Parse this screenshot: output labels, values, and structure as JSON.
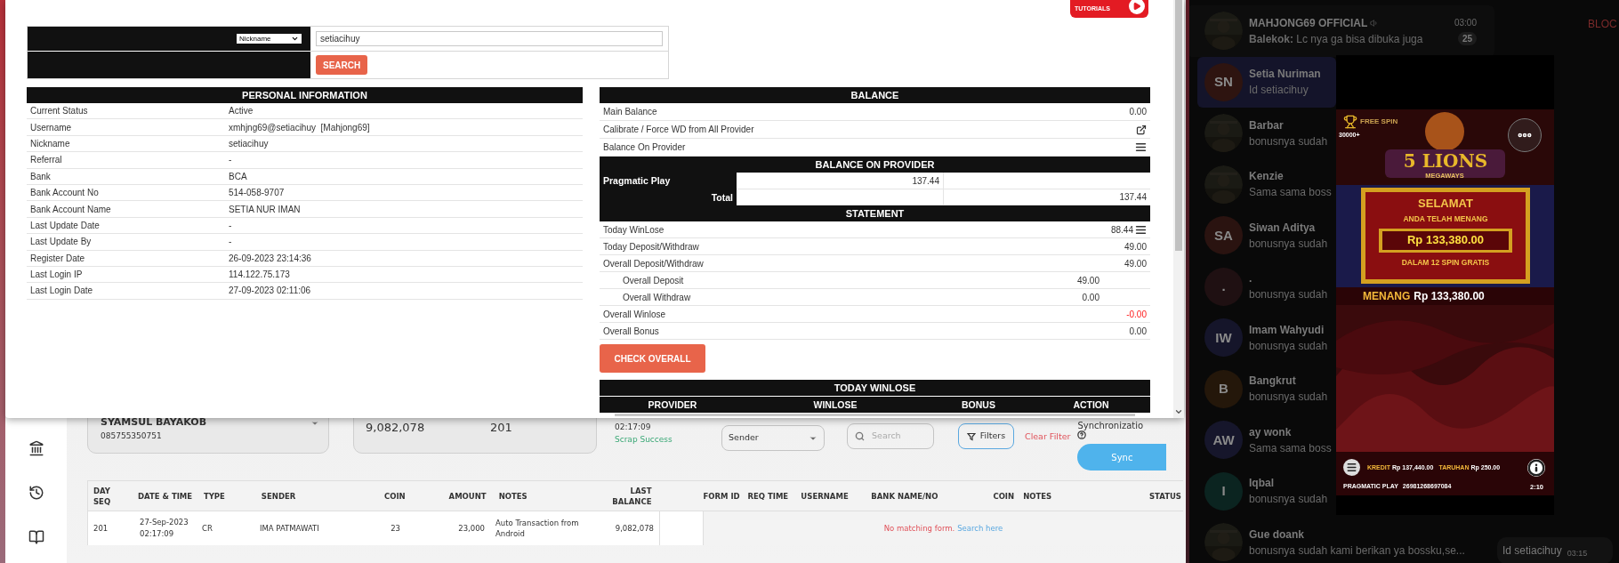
{
  "modal": {
    "logo_text": "TUTORIALS",
    "search": {
      "field": "Nickname",
      "value": "setiacihuy",
      "button": "SEARCH"
    },
    "personal_information": {
      "title": "PERSONAL INFORMATION",
      "rows": [
        {
          "label": "Current Status",
          "value": "Active"
        },
        {
          "label": "Username",
          "value": "xmhjng69@setiacihuy  [Mahjong69]"
        },
        {
          "label": "Nickname",
          "value": "setiacihuy"
        },
        {
          "label": "Referral",
          "value": "-"
        },
        {
          "label": "Bank",
          "value": "BCA"
        },
        {
          "label": "Bank Account No",
          "value": "514-058-9707"
        },
        {
          "label": "Bank Account Name",
          "value": "SETIA NUR IMAN"
        },
        {
          "label": "Last Update Date",
          "value": "-"
        },
        {
          "label": "Last Update By",
          "value": "-"
        },
        {
          "label": "Register Date",
          "value": "26-09-2023 23:14:36"
        },
        {
          "label": "Last Login IP",
          "value": "114.122.75.173"
        },
        {
          "label": "Last Login Date",
          "value": "27-09-2023 02:11:06"
        }
      ]
    },
    "balance": {
      "title": "BALANCE",
      "rows": [
        {
          "label": "Main Balance",
          "kind": "value",
          "value": "0.00"
        },
        {
          "label": "Calibrate / Force WD from All Provider",
          "kind": "share"
        },
        {
          "label": "Balance On Provider",
          "kind": "list"
        }
      ]
    },
    "balance_on_provider": {
      "title": "BALANCE ON PROVIDER",
      "providers": [
        {
          "name": "Pragmatic Play",
          "balance": "137.44"
        }
      ],
      "total_label": "Total",
      "total": "137.44"
    },
    "statement": {
      "title": "STATEMENT",
      "rows": [
        {
          "label": "Today WinLose",
          "value": "88.44",
          "kind": "list",
          "negative": false
        },
        {
          "label": "Today Deposit/Withdraw",
          "value": "49.00",
          "kind": "main",
          "negative": false
        },
        {
          "label": "Overall Deposit/Withdraw",
          "value": "49.00",
          "kind": "main",
          "negative": false
        },
        {
          "label": "Overall Deposit",
          "value": "49.00",
          "kind": "sub",
          "negative": false
        },
        {
          "label": "Overall Withdraw",
          "value": "0.00",
          "kind": "sub",
          "negative": false
        },
        {
          "label": "Overall Winlose",
          "value": "-0.00",
          "kind": "main",
          "negative": true
        },
        {
          "label": "Overall Bonus",
          "value": "0.00",
          "kind": "main",
          "negative": false
        }
      ]
    },
    "check_button": "CHECK OVERALL",
    "today_winlose": {
      "title": "TODAY WINLOSE",
      "columns": [
        "PROVIDER",
        "WINLOSE",
        "BONUS",
        "ACTION"
      ]
    }
  },
  "app": {
    "account": {
      "name": "SYAMSUL BAYAKOB",
      "phone": "085755350751"
    },
    "stats": [
      {
        "value": "9,082,078"
      },
      {
        "value": "201"
      }
    ],
    "status": {
      "time": "02:17:09",
      "text": "Scrap Success"
    },
    "search_by": {
      "value": "Sender"
    },
    "search": {
      "placeholder": "Search"
    },
    "filter": {
      "button": "Filters"
    },
    "clear_filter": "Clear Filter",
    "sync": {
      "label": "Synchronizatio",
      "button": "Sync"
    },
    "table": {
      "columns": [
        "DAY SEQ",
        "DATE & TIME",
        "TYPE",
        "SENDER",
        "COIN",
        "AMOUNT",
        "NOTES",
        "LAST BALANCE",
        "FORM ID",
        "REQ TIME",
        "USERNAME",
        "BANK NAME/NO",
        "COIN",
        "NOTES",
        "STATUS"
      ],
      "rows": [
        {
          "cells": [
            "201",
            "27-Sep-2023 02:17:09",
            "CR",
            "IMA PATMAWATI",
            "23",
            "23,000",
            "Auto Transaction from Android",
            "9,082,078"
          ],
          "form_message": "No matching form.",
          "form_link": "Search here"
        }
      ]
    }
  },
  "messenger": {
    "chats": [
      {
        "name": "MAHJONG69 OFFICIAL",
        "message": "**Balekok:** Lc nya ga bisa dibuka juga",
        "kind": "picture",
        "selected": false,
        "muted": true,
        "time": "03:00",
        "badge": "25"
      },
      {
        "name": "Setia Nuriman",
        "message": "Id setiacihuy",
        "kind": "initials",
        "initials": "SN",
        "color": "#2e1410",
        "selected": true,
        "muted": false
      },
      {
        "name": "Barbar",
        "message": "bonusnya sudah",
        "kind": "picture",
        "selected": false,
        "muted": false
      },
      {
        "name": "Kenzie",
        "message": "Sama sama boss",
        "kind": "picture",
        "selected": false,
        "muted": false
      },
      {
        "name": "Siwan Aditya",
        "message": "bonusnya sudah",
        "kind": "initials",
        "initials": "SA",
        "color": "#2a1310",
        "selected": false,
        "muted": false
      },
      {
        "name": ".",
        "message": "bonusnya sudah",
        "kind": "initials",
        "initials": ".",
        "color": "#1f1012",
        "selected": false,
        "muted": false
      },
      {
        "name": "Imam Wahyudi",
        "message": "bonusnya sudah",
        "kind": "initials",
        "initials": "IW",
        "color": "#15152a",
        "selected": false,
        "muted": false
      },
      {
        "name": "Bangkrut",
        "message": "bonusnya sudah",
        "kind": "initials",
        "initials": "B",
        "color": "#24170a",
        "selected": false,
        "muted": false
      },
      {
        "name": "ay wonk",
        "message": "Sama sama boss",
        "kind": "initials",
        "initials": "AW",
        "color": "#16162b",
        "selected": false,
        "muted": false
      },
      {
        "name": "Iqbal",
        "message": "bonusnya sudah",
        "kind": "initials",
        "initials": "I",
        "color": "#0b2420",
        "selected": false,
        "muted": false
      },
      {
        "name": "Gue doank",
        "message": "bonusnya sudah kami berikan ya bossku,se...",
        "kind": "picture",
        "selected": false,
        "muted": false
      }
    ],
    "block": "BLOC",
    "bubble": {
      "text": "Id setiacihuy",
      "time": "03:15"
    },
    "game": {
      "free_spin": "FREE SPIN",
      "reward": "30000+",
      "title": "5 LIONS",
      "subtitle": "MEGAWAYS",
      "win_title": "SELAMAT",
      "win_subtitle": "ANDA TELAH MENANG",
      "win_amount": "Rp 133,380.00",
      "win_note": "DALAM 12 SPIN GRATIS",
      "total_label": "MENANG",
      "total": "Rp 133,380.00",
      "credit_label": "KREDIT",
      "credit": "Rp 137,440.00",
      "bet_label": "TARUHAN",
      "bet": "Rp 250.00",
      "provider": "PRAGMATIC PLAY",
      "round_id": "26981268697084",
      "time": "2:10"
    }
  }
}
